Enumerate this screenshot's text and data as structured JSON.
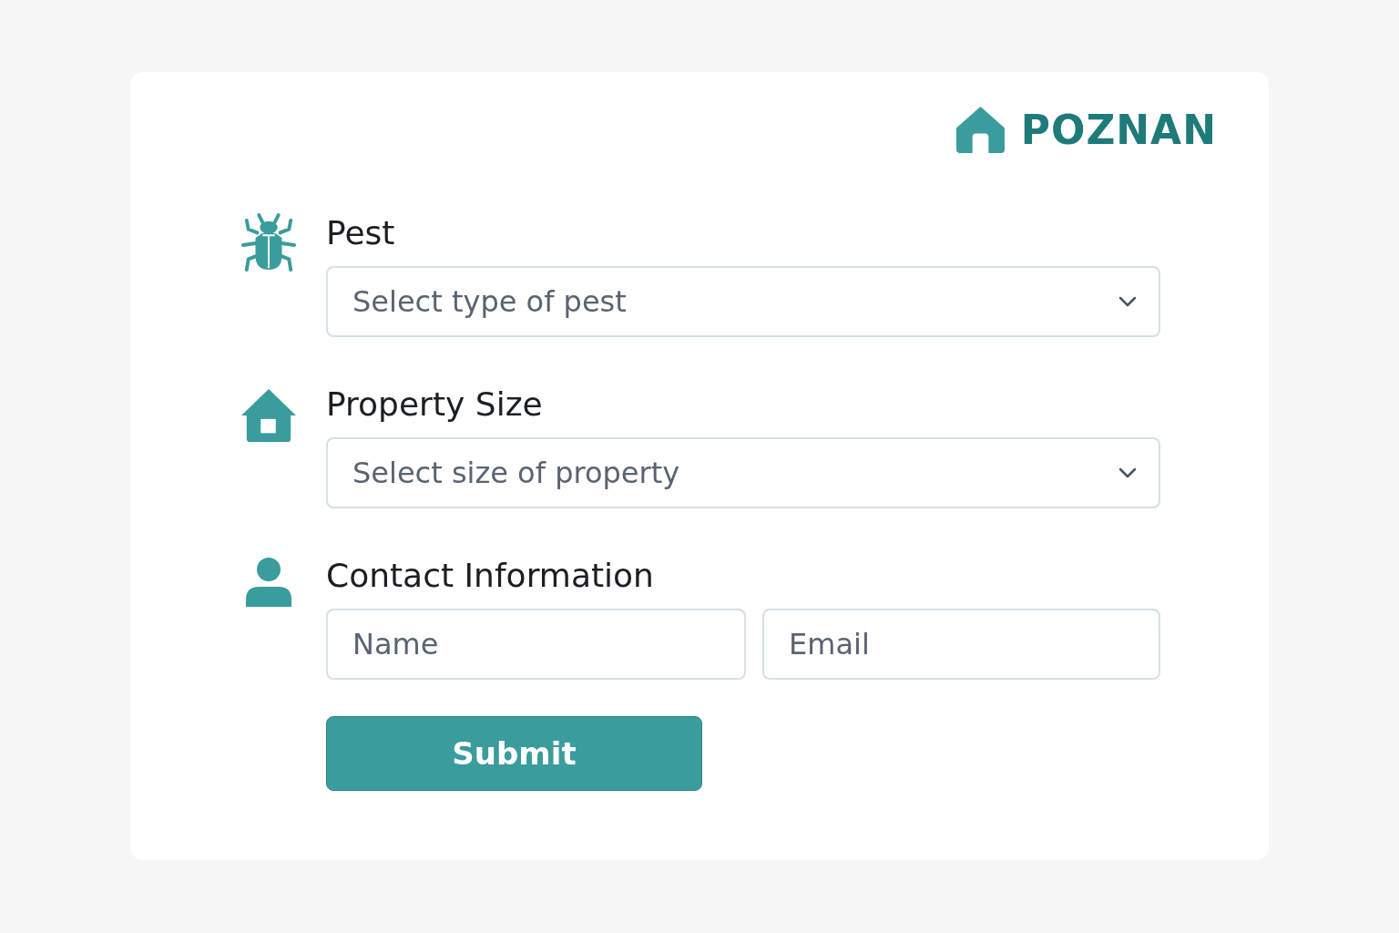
{
  "brand": {
    "name": "POZNAN"
  },
  "sections": [
    {
      "kind": "select",
      "label": "Pest",
      "placeholder": "Select type of pest"
    },
    {
      "kind": "select",
      "label": "Property Size",
      "placeholder": "Select size of property"
    },
    {
      "kind": "inputs",
      "label": "Contact Information",
      "fields": [
        {
          "placeholder": "Name"
        },
        {
          "placeholder": "Email"
        }
      ]
    }
  ],
  "submit": {
    "label": "Submit"
  }
}
